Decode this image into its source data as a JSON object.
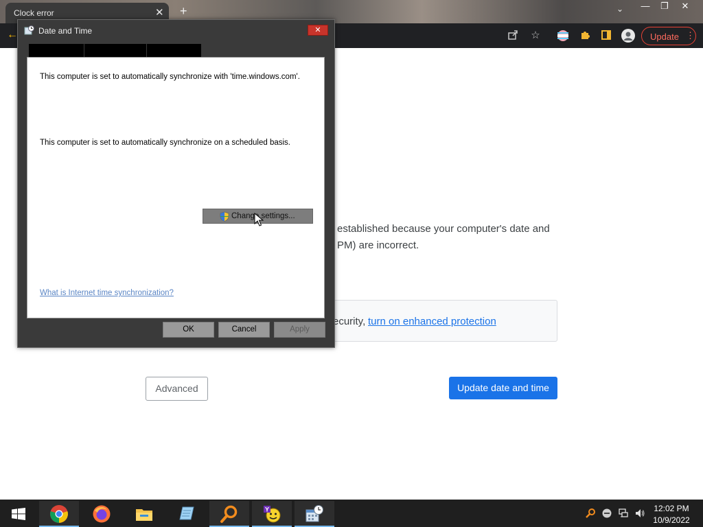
{
  "browser": {
    "tab_title": "Clock error",
    "tab_close_glyph": "✕",
    "new_tab_glyph": "+",
    "tab_search_glyph": "⌄",
    "window_controls": {
      "minimize": "—",
      "maximize": "❐",
      "close": "✕"
    },
    "back_glyph": "←",
    "update_button_label": "Update",
    "menu_glyph": "⋮",
    "accent_update": "#e94235"
  },
  "page": {
    "error_text": "established because your computer's date and PM) are incorrect.",
    "security_prefix": "ecurity,",
    "security_link": "turn on enhanced protection",
    "advanced_button": "Advanced",
    "update_time_button": "Update date and time",
    "primary_color": "#1a73e8"
  },
  "dialog": {
    "title": "Date and Time",
    "close_glyph": "✕",
    "sync_text_1": "This computer is set to automatically synchronize with 'time.windows.com'.",
    "sync_text_2": "This computer is set to automatically synchronize on a scheduled basis.",
    "change_settings_button": "Change settings...",
    "info_link": "What is Internet time synchronization?",
    "ok_button": "OK",
    "cancel_button": "Cancel",
    "apply_button": "Apply"
  },
  "taskbar": {
    "apps": [
      "start-icon",
      "chrome-icon",
      "firefox-icon",
      "file-explorer-icon",
      "notepad-icon",
      "search-app-icon",
      "yahoo-messenger-icon",
      "calendar-clock-icon"
    ],
    "clock_time": "12:02 PM",
    "clock_date": "10/9/2022"
  }
}
